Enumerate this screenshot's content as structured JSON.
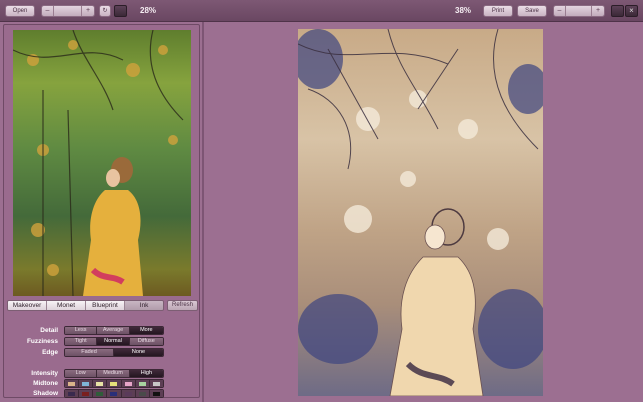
{
  "toolbar": {
    "open_label": "Open",
    "left_zoom": "28%",
    "right_zoom": "38%",
    "print_label": "Print",
    "save_label": "Save"
  },
  "tabs": [
    {
      "label": "Makeover",
      "active": false
    },
    {
      "label": "Monet",
      "active": false
    },
    {
      "label": "Blueprint",
      "active": false
    },
    {
      "label": "Ink",
      "active": true
    }
  ],
  "refresh_label": "Refresh",
  "settings": {
    "detail": {
      "label": "Detail",
      "options": [
        "Less",
        "Average",
        "More"
      ],
      "selected": "More"
    },
    "fuzziness": {
      "label": "Fuzziness",
      "options": [
        "Tight",
        "Normal",
        "Diffuse"
      ],
      "selected": "Normal"
    },
    "edge": {
      "label": "Edge",
      "options": [
        "Faded",
        "None"
      ],
      "selected": "None"
    },
    "intensity": {
      "label": "Intensity",
      "options": [
        "Low",
        "Medium",
        "High"
      ],
      "selected": "High"
    },
    "midtone": {
      "label": "Midtone",
      "colors": [
        "#d9b38a",
        "#7fb4d8",
        "#e8e3a6",
        "#e6e07a",
        "#e7a5c9",
        "#a8d3a0",
        "#c8c8c8"
      ]
    },
    "shadow": {
      "label": "Shadow",
      "colors": [
        "#3a2a4e",
        "#7a1f1f",
        "#2f5d3a",
        "#2a2f7a",
        "#5a3a5a",
        "#4a4a4a",
        "#111111"
      ]
    }
  }
}
